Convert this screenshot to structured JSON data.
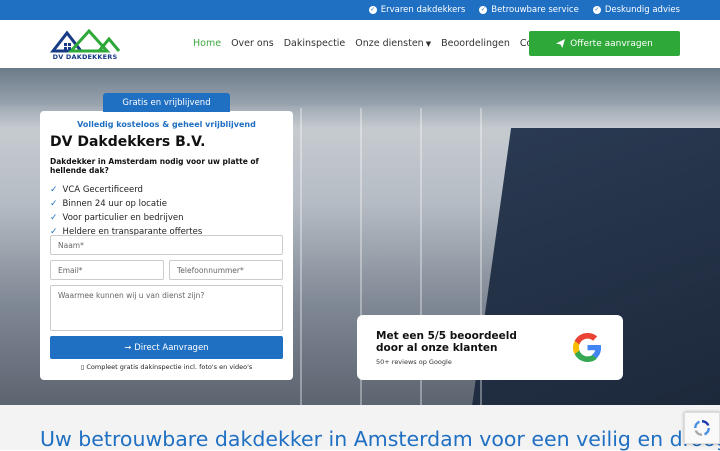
{
  "topbar": {
    "usps": [
      "Ervaren dakdekkers",
      "Betrouwbare service",
      "Deskundig advies"
    ]
  },
  "logo": {
    "text": "DV DAKDEKKERS"
  },
  "nav": {
    "items": [
      "Home",
      "Over ons",
      "Dakinspectie",
      "Onze diensten",
      "Beoordelingen",
      "Contact"
    ],
    "cta": "Offerte aanvragen"
  },
  "hero": {
    "badge": "Gratis en vrijblijvend",
    "form": {
      "subtitle": "Volledig kosteloos & geheel vrijblijvend",
      "title": "DV Dakdekkers B.V.",
      "question": "Dakdekker in Amsterdam nodig voor uw platte of hellende dak?",
      "checks": [
        "VCA Gecertificeerd",
        "Binnen 24 uur op locatie",
        "Voor particulier en bedrijven",
        "Heldere en transparante offertes"
      ],
      "name_placeholder": "Naam*",
      "email_placeholder": "Email*",
      "phone_placeholder": "Telefoonnummer*",
      "message_placeholder": "Waarmee kunnen wij u van dienst zijn?",
      "submit": "➞ Direct Aanvragen",
      "note": "▯ Compleet gratis dakinspectie incl. foto's en video's"
    },
    "review": {
      "title": "Met een 5/5 beoordeeld door al onze klanten",
      "subtitle": "50+ reviews op Google"
    }
  },
  "section": {
    "headline": "Uw betrouwbare dakdekker in Amsterdam voor een veilig en droog"
  },
  "colors": {
    "primary": "#1f6fc2",
    "green": "#2fa83a"
  }
}
